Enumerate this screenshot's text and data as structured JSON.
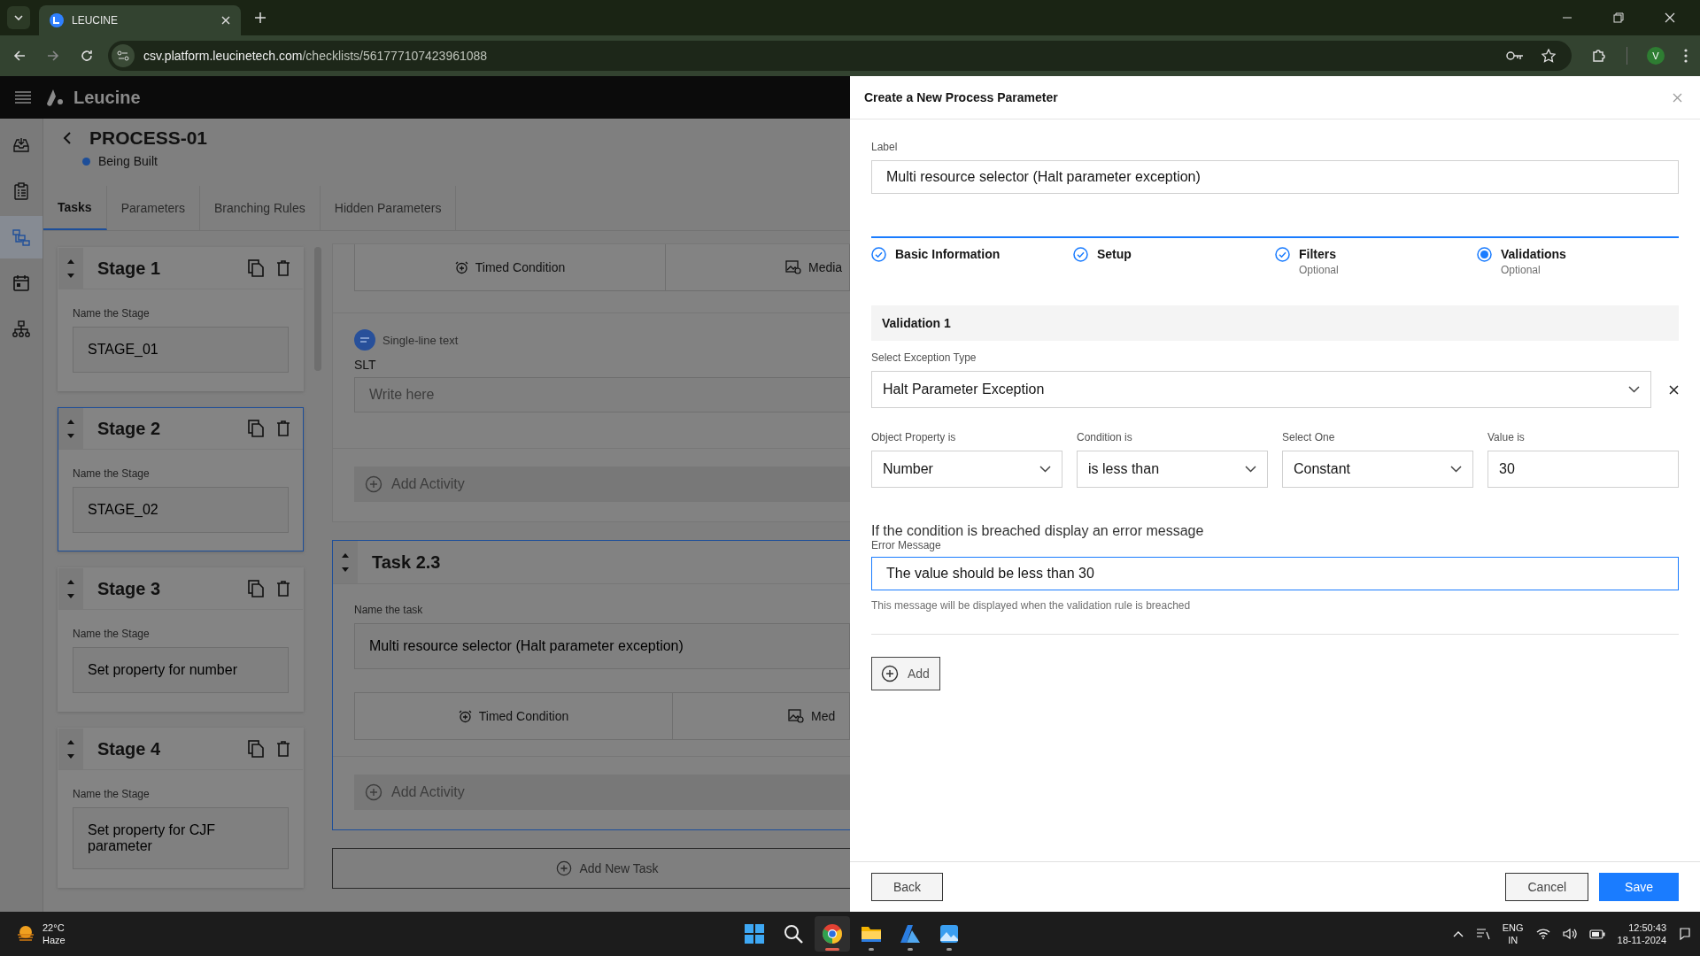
{
  "browser": {
    "tab_title": "LEUCINE",
    "url_host": "csv.platform.leucinetech.com",
    "url_path": "/checklists/561777107423961088",
    "profile": "V"
  },
  "app": {
    "brand": "Leucine",
    "nav": [
      {
        "kind": "inbox",
        "selected": false
      },
      {
        "kind": "checklist",
        "selected": false
      },
      {
        "kind": "flow",
        "selected": true
      },
      {
        "kind": "calendar",
        "selected": false
      },
      {
        "kind": "hierarchy",
        "selected": false
      }
    ]
  },
  "process": {
    "title": "PROCESS-01",
    "status": "Being Built"
  },
  "tabs": [
    {
      "label": "Tasks",
      "selected": true
    },
    {
      "label": "Parameters",
      "selected": false
    },
    {
      "label": "Branching Rules",
      "selected": false
    },
    {
      "label": "Hidden Parameters",
      "selected": false
    }
  ],
  "stages": [
    {
      "title": "Stage 1",
      "field_label": "Name the Stage",
      "value": "STAGE_01",
      "selected": false
    },
    {
      "title": "Stage 2",
      "field_label": "Name the Stage",
      "value": "STAGE_02",
      "selected": true
    },
    {
      "title": "Stage 3",
      "field_label": "Name the Stage",
      "value": "Set property for number",
      "selected": false
    },
    {
      "title": "Stage 4",
      "field_label": "Name the Stage",
      "value": "Set property for CJF parameter",
      "selected": false
    }
  ],
  "task_above": {
    "conditions": [
      "Timed Condition",
      "Media"
    ],
    "activity_type": "Single-line text",
    "activity_label": "SLT",
    "placeholder": "Write here",
    "add_activity": "Add Activity"
  },
  "task": {
    "title": "Task 2.3",
    "field_label": "Name the task",
    "value": "Multi resource selector (Halt parameter exception)",
    "conditions": [
      "Timed Condition",
      "Med"
    ],
    "add_activity": "Add Activity",
    "selected": true
  },
  "add_task": "Add New Task",
  "drawer": {
    "title": "Create a New Process Parameter",
    "label_caption": "Label",
    "label_value": "Multi resource selector (Halt parameter exception)",
    "steps": [
      {
        "label": "Basic Information",
        "completed": true,
        "selected": false
      },
      {
        "label": "Setup",
        "completed": true,
        "selected": false
      },
      {
        "label": "Filters",
        "sub": "Optional",
        "completed": true,
        "selected": false
      },
      {
        "label": "Validations",
        "sub": "Optional",
        "completed": false,
        "selected": true
      }
    ],
    "validation_title": "Validation 1",
    "exception_caption": "Select Exception Type",
    "exception_value": "Halt Parameter Exception",
    "conditions": [
      {
        "caption": "Object Property is",
        "value": "Number",
        "kind": "select"
      },
      {
        "caption": "Condition is",
        "value": "is less than",
        "kind": "select"
      },
      {
        "caption": "Select One",
        "value": "Constant",
        "kind": "select"
      },
      {
        "caption": "Value is",
        "value": "30",
        "kind": "input"
      }
    ],
    "breach_heading": "If the condition is breached display an error message",
    "error_caption": "Error Message",
    "error_value": "The value should be less than 30",
    "error_help": "This message will be displayed when the validation rule is breached",
    "add_label": "Add",
    "back": "Back",
    "cancel": "Cancel",
    "save": "Save"
  },
  "taskbar": {
    "temperature": "22°C",
    "weather": "Haze",
    "apps": [
      {
        "kind": "start",
        "running": false,
        "active": false
      },
      {
        "kind": "search",
        "running": false,
        "active": false
      },
      {
        "kind": "chrome",
        "running": true,
        "active": true
      },
      {
        "kind": "files",
        "running": true,
        "active": false
      },
      {
        "kind": "azure",
        "running": true,
        "active": false
      },
      {
        "kind": "photos",
        "running": true,
        "active": false
      }
    ],
    "lang": "ENG",
    "region": "IN",
    "time": "12:50:43",
    "date": "18-11-2024"
  }
}
